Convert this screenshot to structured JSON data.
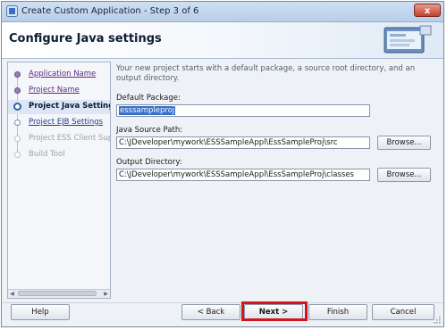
{
  "window": {
    "title": "Create Custom Application - Step 3 of 6",
    "close_label": "x"
  },
  "header": {
    "heading": "Configure Java settings"
  },
  "steps": [
    {
      "label": "Application Name",
      "state": "done"
    },
    {
      "label": "Project Name",
      "state": "done"
    },
    {
      "label": "Project Java Settings",
      "state": "current"
    },
    {
      "label": "Project EJB Settings",
      "state": "next"
    },
    {
      "label": "Project ESS Client Support",
      "state": "disabled"
    },
    {
      "label": "Build Tool",
      "state": "disabled"
    }
  ],
  "intro_text": "Your new project starts with a default package, a source root directory, and an output directory.",
  "form": {
    "default_package_label": "Default Package:",
    "default_package_value": "esssampleproj",
    "java_source_label": "Java Source Path:",
    "java_source_value": "C:\\JDeveloper\\mywork\\ESSSampleAppl\\EssSampleProj\\src",
    "output_dir_label": "Output Directory:",
    "output_dir_value": "C:\\JDeveloper\\mywork\\ESSSampleAppl\\EssSampleProj\\classes",
    "browse_label": "Browse..."
  },
  "buttons": {
    "help": "Help",
    "back": "< Back",
    "next": "Next >",
    "finish": "Finish",
    "cancel": "Cancel"
  },
  "colors": {
    "highlight": "#d4141c",
    "selection": "#3a6fc8",
    "visited_link": "#5a2a80"
  }
}
